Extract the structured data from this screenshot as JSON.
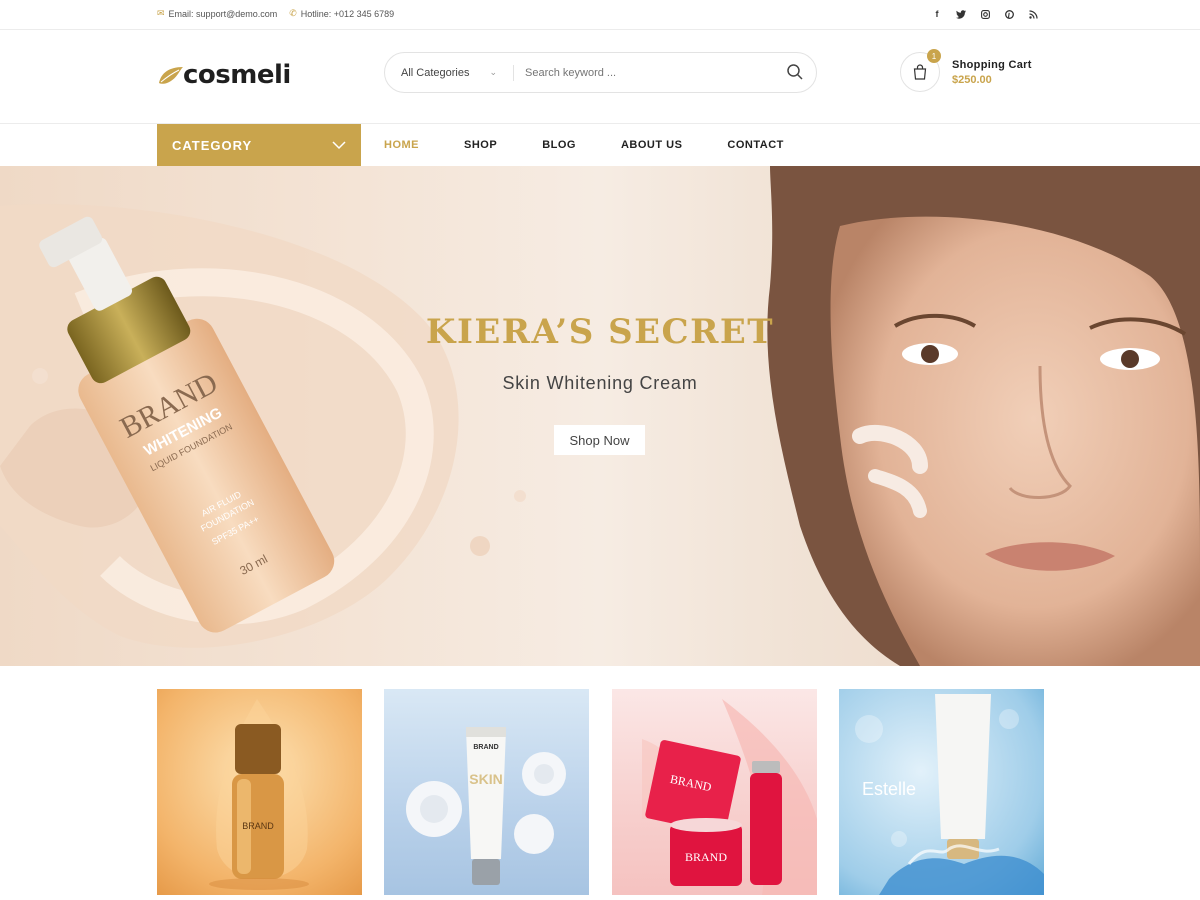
{
  "topbar": {
    "email": "Email: support@demo.com",
    "hotline": "Hotline: +012 345 6789",
    "social": [
      "facebook-icon",
      "twitter-icon",
      "instagram-icon",
      "pinterest-icon",
      "rss-icon"
    ]
  },
  "header": {
    "logo_text": "cosmeli",
    "search": {
      "category": "All Categories",
      "placeholder": "Search keyword ..."
    },
    "cart": {
      "count": "1",
      "label": "Shopping Cart",
      "total": "$250.00"
    }
  },
  "nav": {
    "category_label": "CATEGORY",
    "items": [
      {
        "label": "HOME",
        "active": true
      },
      {
        "label": "SHOP",
        "active": false
      },
      {
        "label": "BLOG",
        "active": false
      },
      {
        "label": "ABOUT US",
        "active": false
      },
      {
        "label": "CONTACT",
        "active": false
      }
    ]
  },
  "hero": {
    "title": "KIERA’S SECRET",
    "subtitle": "Skin Whitening Cream",
    "button": "Shop Now",
    "bottle_text": [
      "BRAND",
      "WHITENING",
      "LIQUID FOUNDATION",
      "AIR FLUID",
      "FOUNDATION",
      "SPF35 PA++",
      "30 ml"
    ]
  },
  "tiles": [
    {
      "text": "BRAND"
    },
    {
      "text": "BRAND",
      "text2": "SKIN"
    },
    {
      "text": "BRAND",
      "text2": "BRAND"
    },
    {
      "text": "Estelle"
    }
  ],
  "colors": {
    "accent": "#c9a44c",
    "dark": "#222222"
  }
}
